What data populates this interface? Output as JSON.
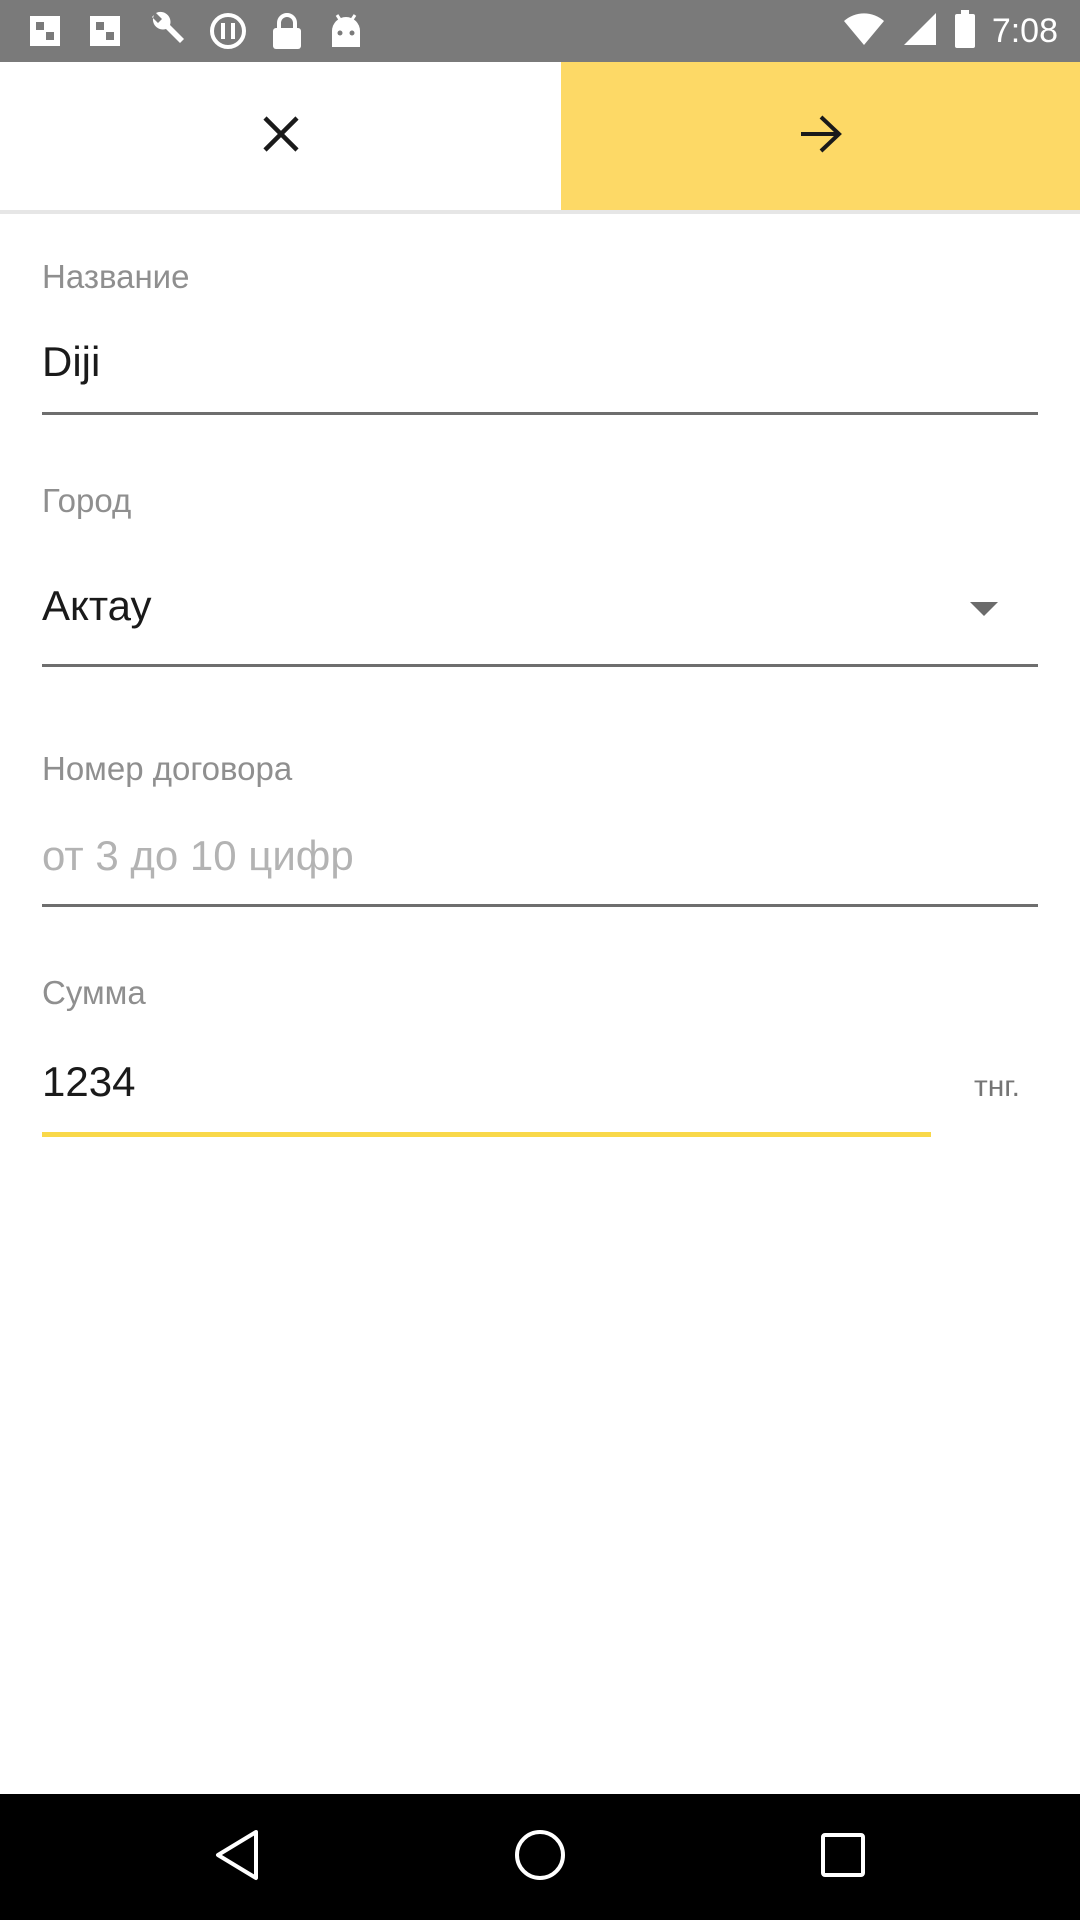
{
  "status_bar": {
    "time": "7:08",
    "icons": [
      "image-icon",
      "image-icon",
      "wrench-icon",
      "sync-icon",
      "lock-icon",
      "android-icon"
    ],
    "right_icons": [
      "wifi-icon",
      "signal-icon",
      "battery-icon"
    ]
  },
  "action_bar": {
    "close_icon": "close-icon",
    "next_icon": "arrow-right-icon",
    "accent_color": "#fdd966"
  },
  "form": {
    "name": {
      "label": "Название",
      "value": "Diji"
    },
    "city": {
      "label": "Город",
      "value": "Актау"
    },
    "contract": {
      "label": "Номер договора",
      "placeholder": "от 3 до 10 цифр",
      "value": ""
    },
    "amount": {
      "label": "Сумма",
      "value": "1234",
      "currency": "тнг.",
      "underline_color": "#f9d849"
    }
  },
  "nav_bar": {
    "back_icon": "back-triangle-icon",
    "home_icon": "home-circle-icon",
    "recents_icon": "recents-square-icon"
  }
}
